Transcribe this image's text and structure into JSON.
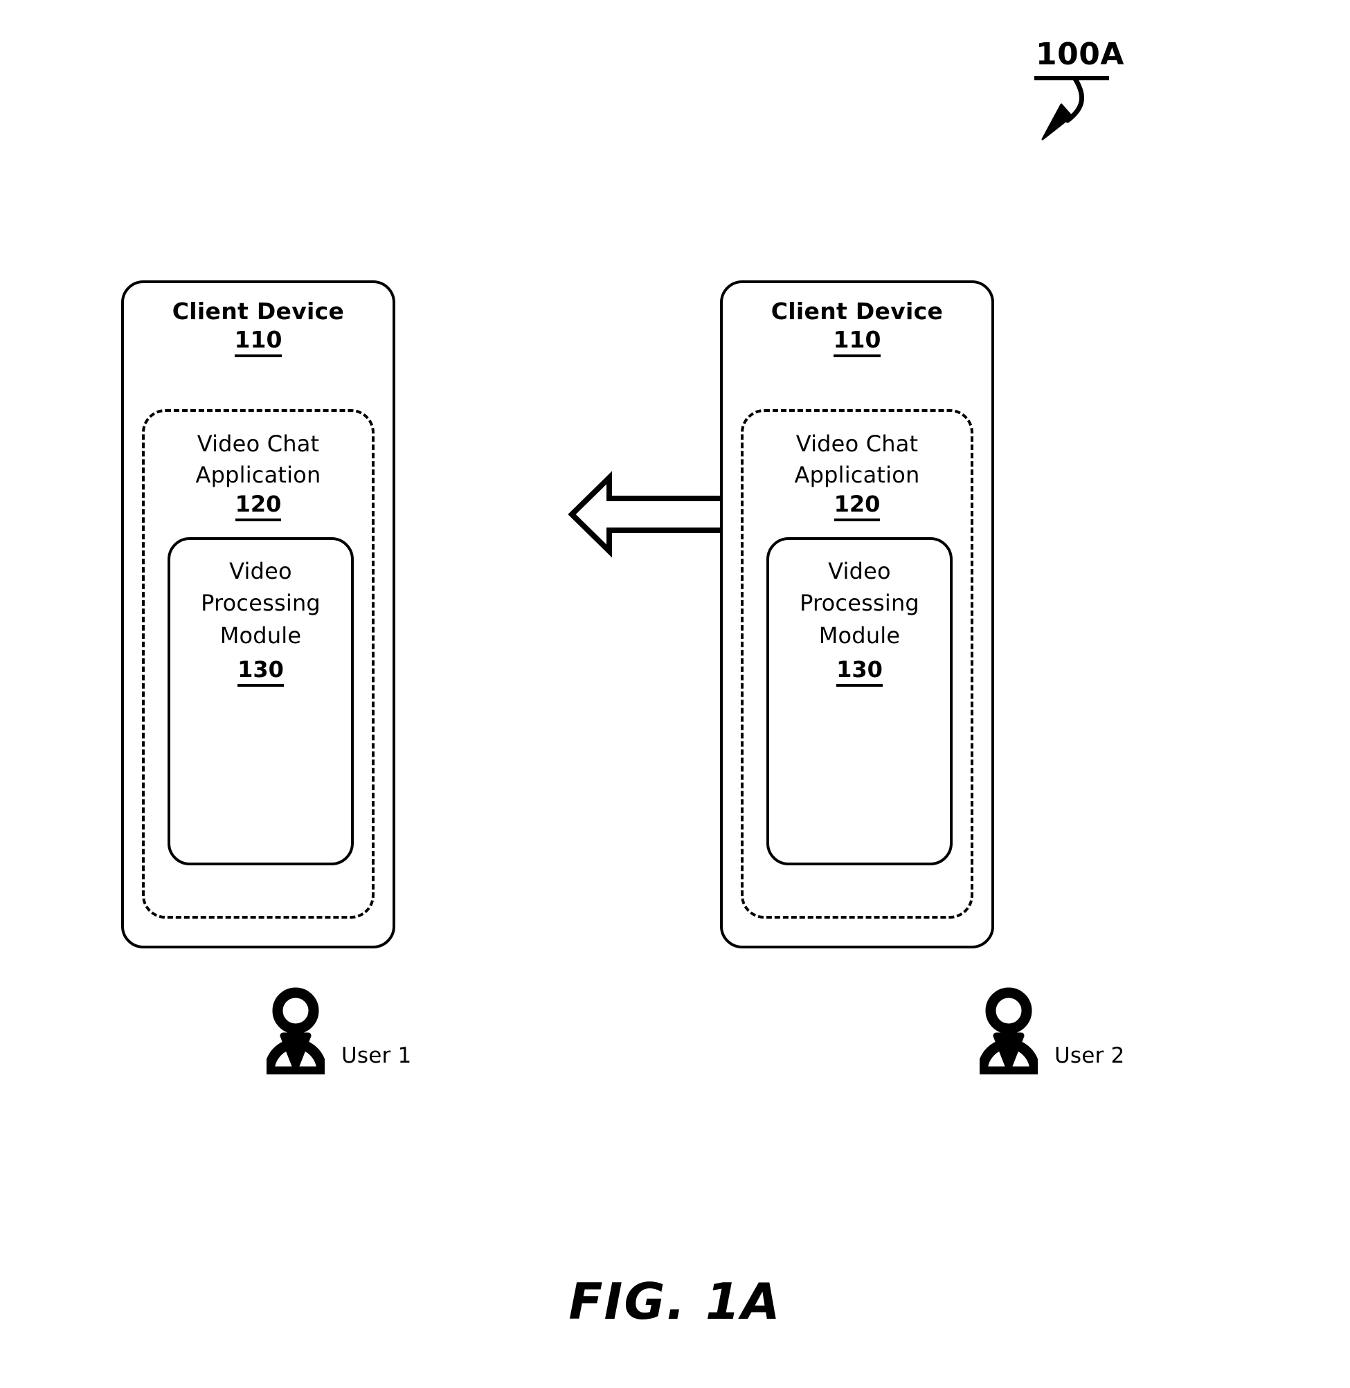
{
  "figure": {
    "reference_label": "100A",
    "caption": "FIG. 1A"
  },
  "devices": [
    {
      "side": "left",
      "title": "Client Device",
      "ref": "110",
      "application": {
        "title_line1": "Video Chat",
        "title_line2": "Application",
        "ref": "120",
        "module": {
          "title_line1": "Video",
          "title_line2": "Processing",
          "title_line3": "Module",
          "ref": "130"
        }
      },
      "user": {
        "label": "User 1",
        "icon": "user-person-icon"
      }
    },
    {
      "side": "right",
      "title": "Client Device",
      "ref": "110",
      "application": {
        "title_line1": "Video Chat",
        "title_line2": "Application",
        "ref": "120",
        "module": {
          "title_line1": "Video",
          "title_line2": "Processing",
          "title_line3": "Module",
          "ref": "130"
        }
      },
      "user": {
        "label": "User 2",
        "icon": "user-person-icon"
      }
    }
  ],
  "connector": {
    "type": "double-headed-arrow",
    "direction": "bidirectional",
    "icon": "bidirectional-arrow-icon"
  },
  "colors": {
    "stroke": "#000000",
    "background": "#ffffff"
  }
}
